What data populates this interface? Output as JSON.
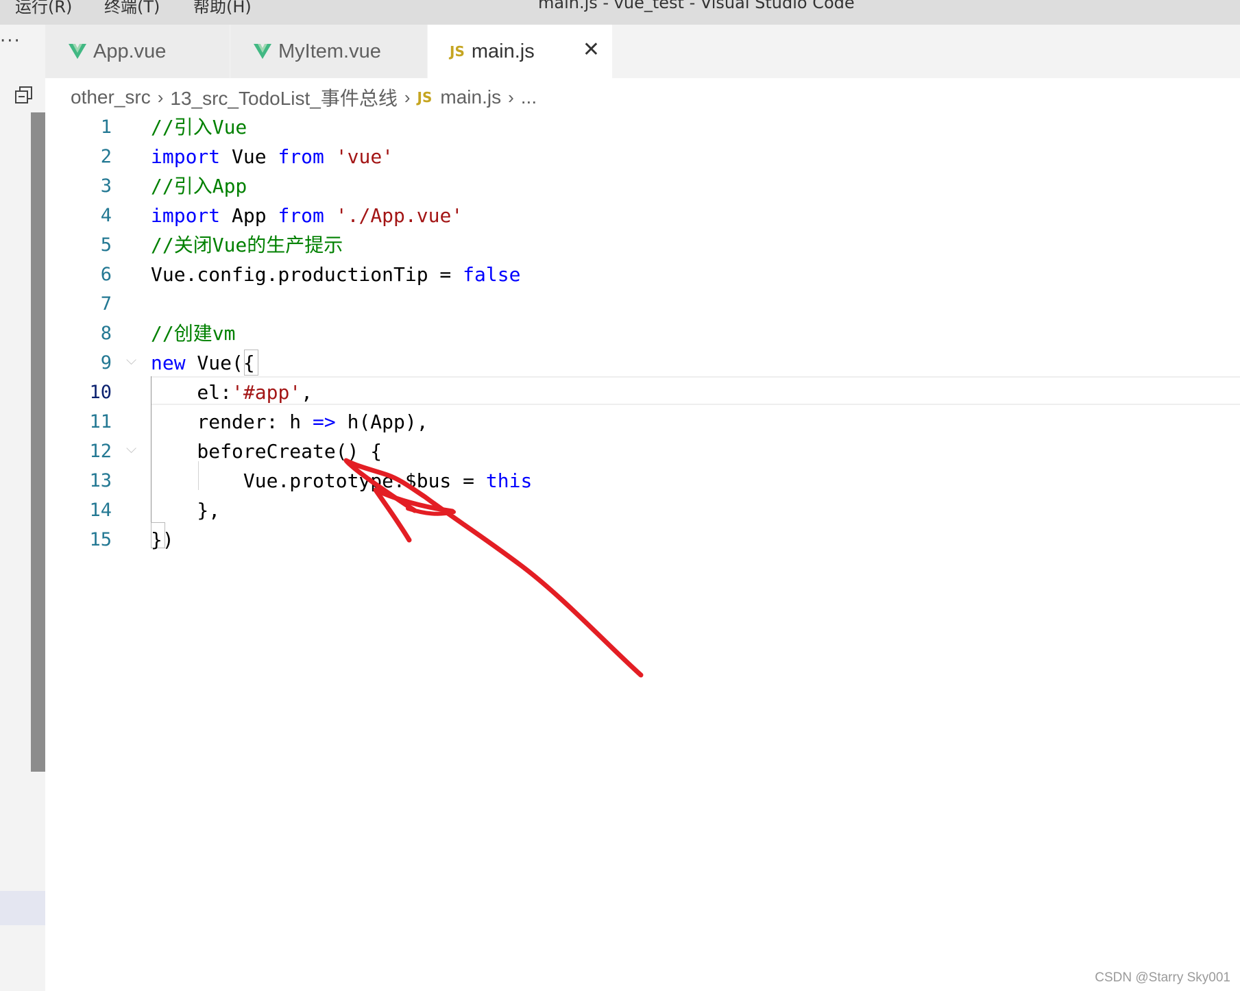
{
  "window": {
    "menus": [
      "运行(R)",
      "终端(T)",
      "帮助(H)"
    ],
    "title": "main.js - vue_test - Visual Studio Code"
  },
  "activity": {
    "more_label": "···",
    "split_icon": "split-editor-icon"
  },
  "tabs": [
    {
      "label": "App.vue",
      "icon": "vue-icon",
      "active": false
    },
    {
      "label": "MyItem.vue",
      "icon": "vue-icon",
      "active": false
    },
    {
      "label": "main.js",
      "icon": "js-icon",
      "icon_text": "JS",
      "active": true,
      "close": "✕"
    }
  ],
  "breadcrumb": {
    "items": [
      "other_src",
      "13_src_TodoList_事件总线",
      "main.js",
      "..."
    ],
    "sep": "›",
    "js_text": "JS"
  },
  "editor": {
    "current_line": 10,
    "line_numbers": [
      "1",
      "2",
      "3",
      "4",
      "5",
      "6",
      "7",
      "8",
      "9",
      "10",
      "11",
      "12",
      "13",
      "14",
      "15"
    ],
    "lines": [
      "//引入Vue",
      "import Vue from 'vue'",
      "//引入App",
      "import App from './App.vue'",
      "//关闭Vue的生产提示",
      "Vue.config.productionTip = false",
      "",
      "//创建vm",
      "new Vue({",
      "    el:'#app',",
      "    render: h => h(App),",
      "    beforeCreate() {",
      "        Vue.prototype.$bus = this",
      "    },",
      "})"
    ],
    "tokens": {
      "l1_cm": "//引入Vue",
      "l2_kw1": "import",
      "l2_t1": " Vue ",
      "l2_kw2": "from",
      "l2_t2": " ",
      "l2_str": "'vue'",
      "l3_cm": "//引入App",
      "l4_kw1": "import",
      "l4_t1": " App ",
      "l4_kw2": "from",
      "l4_t2": " ",
      "l4_str": "'./App.vue'",
      "l5_cm": "//关闭Vue的生产提示",
      "l6_t1": "Vue.config.productionTip = ",
      "l6_kw": "false",
      "l8_cm": "//创建vm",
      "l9_kw": "new",
      "l9_t1": " Vue({",
      "l10_t1": "    el:",
      "l10_str": "'#app'",
      "l10_t2": ",",
      "l11_t1": "    render: h ",
      "l11_kw": "=>",
      "l11_t2": " h(App),",
      "l12_t1": "    beforeCreate() {",
      "l13_t1": "        Vue.prototype.$bus = ",
      "l13_kw": "this",
      "l14_t1": "    },",
      "l15_t1": "})"
    },
    "fold_marker": "⌵"
  },
  "colors": {
    "keyword": "#0000ff",
    "string": "#a31515",
    "comment": "#008000",
    "line_number": "#237893",
    "annotation_arrow": "#e31e24"
  },
  "watermark": "CSDN @Starry Sky001"
}
